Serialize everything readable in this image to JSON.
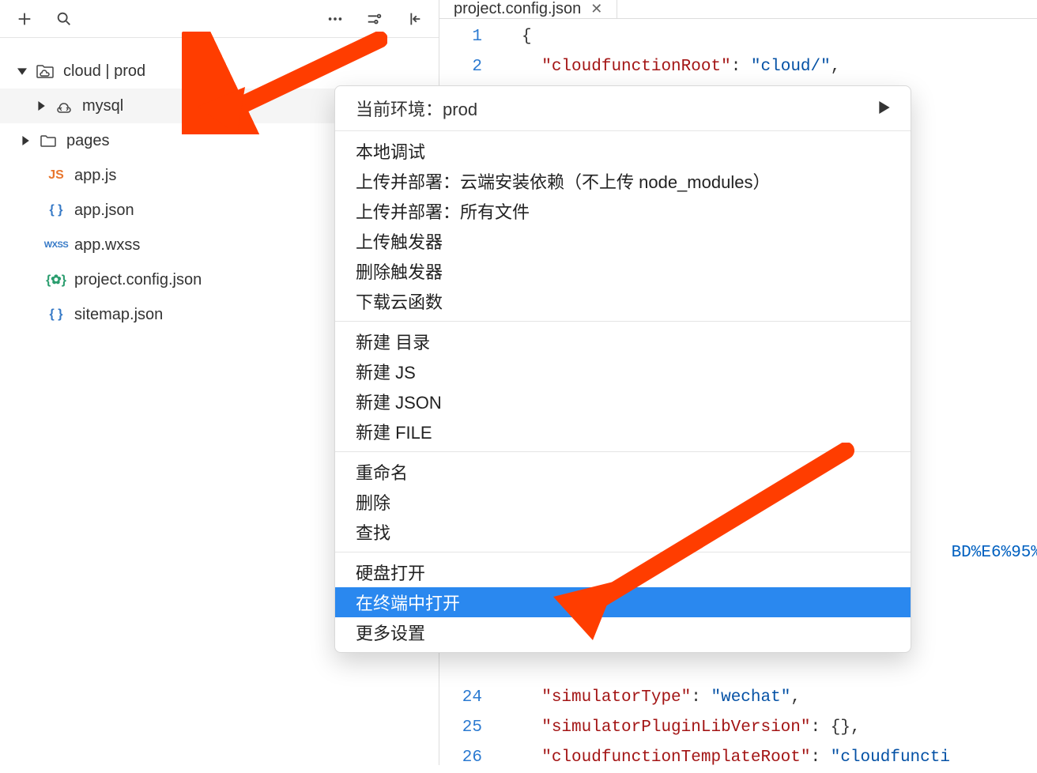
{
  "colors": {
    "accent": "#2a88ef",
    "annotation": "#ff3d00",
    "key": "#a31515",
    "string": "#0451a5",
    "gutter": "#2b7ad1"
  },
  "sidebar": {
    "tree": [
      {
        "label": "cloud | prod",
        "icon": "cloud-folder",
        "expanded": true,
        "level": 0
      },
      {
        "label": "mysql",
        "icon": "cloud-fn",
        "expanded": false,
        "level": 1,
        "highlight": true
      },
      {
        "label": "pages",
        "icon": "folder",
        "expanded": false,
        "level": 0
      },
      {
        "label": "app.js",
        "icon": "js",
        "leaf": true
      },
      {
        "label": "app.json",
        "icon": "json",
        "leaf": true
      },
      {
        "label": "app.wxss",
        "icon": "wxss",
        "leaf": true
      },
      {
        "label": "project.config.json",
        "icon": "config",
        "leaf": true
      },
      {
        "label": "sitemap.json",
        "icon": "json",
        "leaf": true
      }
    ]
  },
  "editor": {
    "tab": {
      "name": "project.config.json"
    },
    "lines": [
      {
        "n": 1,
        "raw": "{"
      },
      {
        "n": 2,
        "key": "cloudfunctionRoot",
        "val": "cloud/"
      },
      {
        "n": 24,
        "key": "simulatorType",
        "val": "wechat"
      },
      {
        "n": 25,
        "key": "simulatorPluginLibVersion",
        "obj": "{}"
      },
      {
        "n": 26,
        "key": "cloudfunctionTemplateRoot",
        "valpartial": "cloudfuncti"
      }
    ],
    "ghost_link_fragment": "BD%E6%95%"
  },
  "context_menu": {
    "header_label": "当前环境：",
    "header_value": "prod",
    "groups": [
      [
        "本地调试",
        "上传并部署：云端安装依赖（不上传 node_modules）",
        "上传并部署：所有文件",
        "上传触发器",
        "删除触发器",
        "下载云函数"
      ],
      [
        "新建 目录",
        "新建 JS",
        "新建 JSON",
        "新建 FILE"
      ],
      [
        "重命名",
        "删除",
        "查找"
      ],
      [
        "硬盘打开",
        "在终端中打开",
        "更多设置"
      ]
    ],
    "selected": "在终端中打开"
  }
}
